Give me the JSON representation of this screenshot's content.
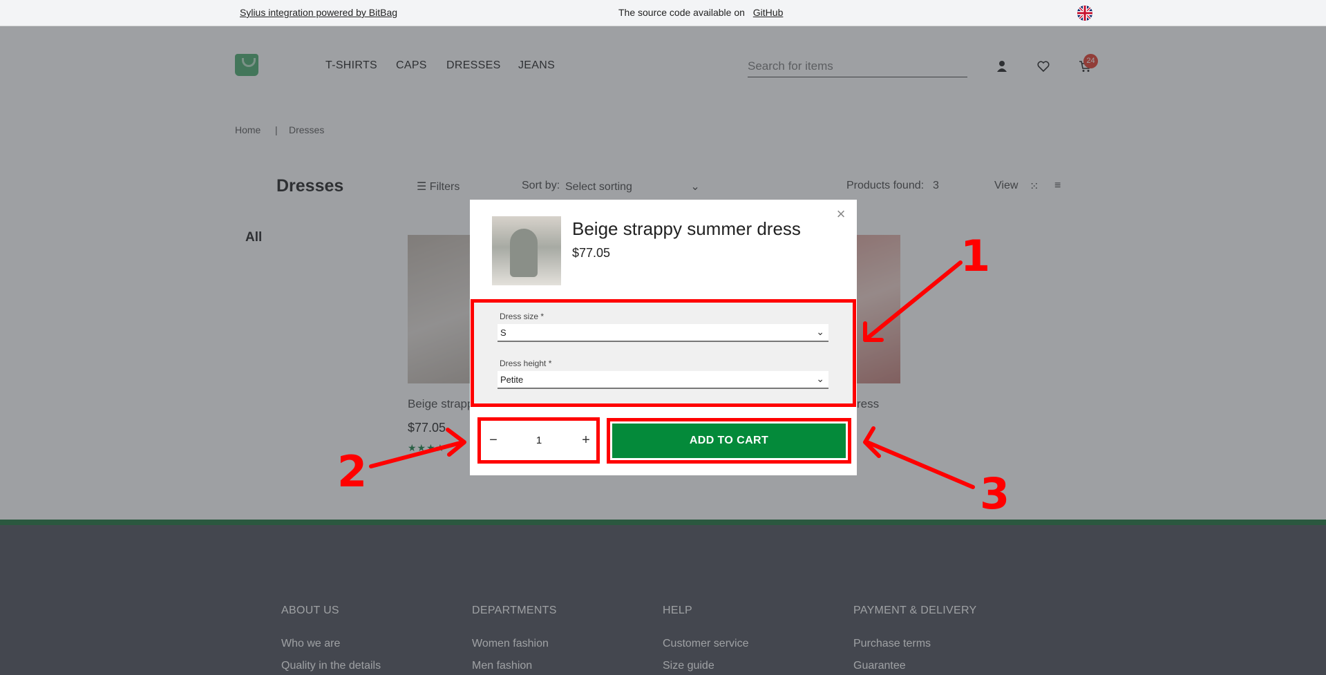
{
  "topbar": {
    "left_link": "Sylius integration powered by BitBag",
    "center_text": "The source code available on",
    "center_link": "GitHub",
    "flag_icon": "uk-flag-icon"
  },
  "header": {
    "nav": [
      "T-SHIRTS",
      "CAPS",
      "DRESSES",
      "JEANS"
    ],
    "search_placeholder": "Search for items",
    "cart_count": "24"
  },
  "breadcrumb": {
    "home": "Home",
    "separator": "|",
    "current": "Dresses"
  },
  "listing": {
    "title": "Dresses",
    "filters": "Filters",
    "sort_label": "Sort by:",
    "sort_value": "Select sorting",
    "found_label": "Products found:",
    "found_count": "3",
    "view_label": "View",
    "sidebar_all": "All",
    "products": [
      {
        "name": "Beige strapp",
        "price": "$77.05",
        "stars": "★★★★"
      },
      {
        "name": "ress",
        "price": "",
        "stars": ""
      }
    ]
  },
  "footer": {
    "columns": [
      {
        "heading": "ABOUT US",
        "links": [
          "Who we are",
          "Quality in the details"
        ]
      },
      {
        "heading": "DEPARTMENTS",
        "links": [
          "Women fashion",
          "Men fashion"
        ]
      },
      {
        "heading": "HELP",
        "links": [
          "Customer service",
          "Size guide"
        ]
      },
      {
        "heading": "PAYMENT & DELIVERY",
        "links": [
          "Purchase terms",
          "Guarantee"
        ]
      }
    ]
  },
  "modal": {
    "title": "Beige strappy summer dress",
    "price": "$77.05",
    "close": "×",
    "size_label": "Dress size *",
    "size_value": "S",
    "height_label": "Dress height *",
    "height_value": "Petite",
    "qty_minus": "−",
    "qty_value": "1",
    "qty_plus": "+",
    "add_to_cart": "ADD TO CART"
  },
  "annotations": {
    "one": "1",
    "two": "2",
    "three": "3"
  },
  "colors": {
    "accent_green": "#048a3a",
    "annotation_red": "#ff0000",
    "badge_red": "#e74c3c"
  }
}
